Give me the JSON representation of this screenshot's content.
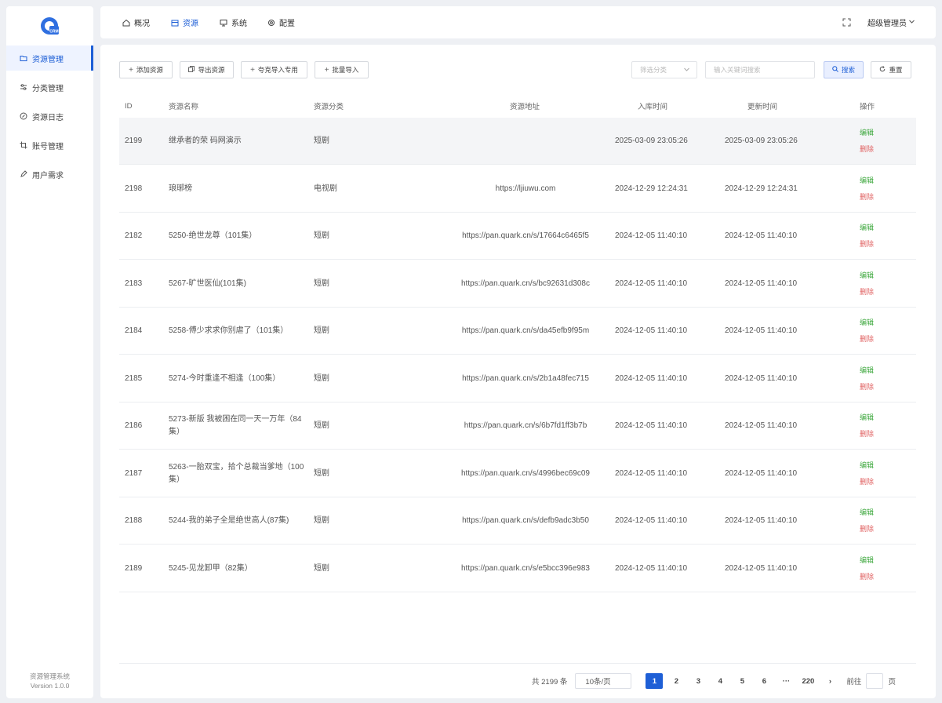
{
  "sidebar": {
    "items": [
      {
        "label": "资源管理",
        "icon": "folder-icon"
      },
      {
        "label": "分类管理",
        "icon": "sliders-icon"
      },
      {
        "label": "资源日志",
        "icon": "compass-icon"
      },
      {
        "label": "账号管理",
        "icon": "crop-icon"
      },
      {
        "label": "用户需求",
        "icon": "pencil-icon"
      }
    ],
    "footer_title": "资源管理系统",
    "footer_version": "Version 1.0.0"
  },
  "topbar": {
    "tabs": [
      {
        "label": "概况",
        "icon": "home-icon"
      },
      {
        "label": "资源",
        "icon": "box-icon"
      },
      {
        "label": "系统",
        "icon": "monitor-icon"
      },
      {
        "label": "配置",
        "icon": "gear-icon"
      }
    ],
    "user_label": "超级管理员"
  },
  "toolbar": {
    "add_label": "添加资源",
    "export_label": "导出资源",
    "quark_import_label": "夸克导入专用",
    "batch_import_label": "批量导入",
    "category_placeholder": "筛选分类",
    "keyword_placeholder": "输入关键词搜索",
    "search_label": "搜索",
    "reset_label": "重置"
  },
  "table": {
    "headers": {
      "id": "ID",
      "name": "资源名称",
      "category": "资源分类",
      "url": "资源地址",
      "created": "入库时间",
      "updated": "更新时间",
      "ops": "操作"
    },
    "edit_label": "编辑",
    "delete_label": "删除",
    "rows": [
      {
        "id": "2199",
        "name": "继承者的荣     码网演示",
        "category": "短剧",
        "url": "",
        "created": "2025-03-09 23:05:26",
        "updated": "2025-03-09 23:05:26"
      },
      {
        "id": "2198",
        "name": "琅琊榜",
        "category": "电视剧",
        "url": "https://ljiuwu.com",
        "created": "2024-12-29 12:24:31",
        "updated": "2024-12-29 12:24:31"
      },
      {
        "id": "2182",
        "name": "5250-绝世龙尊（101集）",
        "category": "短剧",
        "url": "https://pan.quark.cn/s/17664c6465f5",
        "created": "2024-12-05 11:40:10",
        "updated": "2024-12-05 11:40:10"
      },
      {
        "id": "2183",
        "name": "5267-旷世医仙(101集)",
        "category": "短剧",
        "url": "https://pan.quark.cn/s/bc92631d308c",
        "created": "2024-12-05 11:40:10",
        "updated": "2024-12-05 11:40:10"
      },
      {
        "id": "2184",
        "name": "5258-傅少求求你别虐了（101集）",
        "category": "短剧",
        "url": "https://pan.quark.cn/s/da45efb9f95m",
        "created": "2024-12-05 11:40:10",
        "updated": "2024-12-05 11:40:10"
      },
      {
        "id": "2185",
        "name": "5274-今时重逢不相逢（100集）",
        "category": "短剧",
        "url": "https://pan.quark.cn/s/2b1a48fec715",
        "created": "2024-12-05 11:40:10",
        "updated": "2024-12-05 11:40:10"
      },
      {
        "id": "2186",
        "name": "5273-新版 我被困在同一天一万年（84集）",
        "category": "短剧",
        "url": "https://pan.quark.cn/s/6b7fd1ff3b7b",
        "created": "2024-12-05 11:40:10",
        "updated": "2024-12-05 11:40:10"
      },
      {
        "id": "2187",
        "name": "5263-一胎双宝，拾个总裁当爹地（100集）",
        "category": "短剧",
        "url": "https://pan.quark.cn/s/4996bec69c09",
        "created": "2024-12-05 11:40:10",
        "updated": "2024-12-05 11:40:10"
      },
      {
        "id": "2188",
        "name": "5244-我的弟子全是绝世高人(87集)",
        "category": "短剧",
        "url": "https://pan.quark.cn/s/defb9adc3b50",
        "created": "2024-12-05 11:40:10",
        "updated": "2024-12-05 11:40:10"
      },
      {
        "id": "2189",
        "name": "5245-见龙卸甲（82集）",
        "category": "短剧",
        "url": "https://pan.quark.cn/s/e5bcc396e983",
        "created": "2024-12-05 11:40:10",
        "updated": "2024-12-05 11:40:10"
      }
    ]
  },
  "pagination": {
    "total": "共 2199 条",
    "page_size": "10条/页",
    "pages": [
      "1",
      "2",
      "3",
      "4",
      "5",
      "6",
      "···",
      "220"
    ],
    "next": "›",
    "goto_label": "前往",
    "goto_suffix": "页"
  },
  "colors": {
    "accent": "#1e5fd6",
    "edit": "#3ea83e",
    "delete": "#e06060"
  }
}
